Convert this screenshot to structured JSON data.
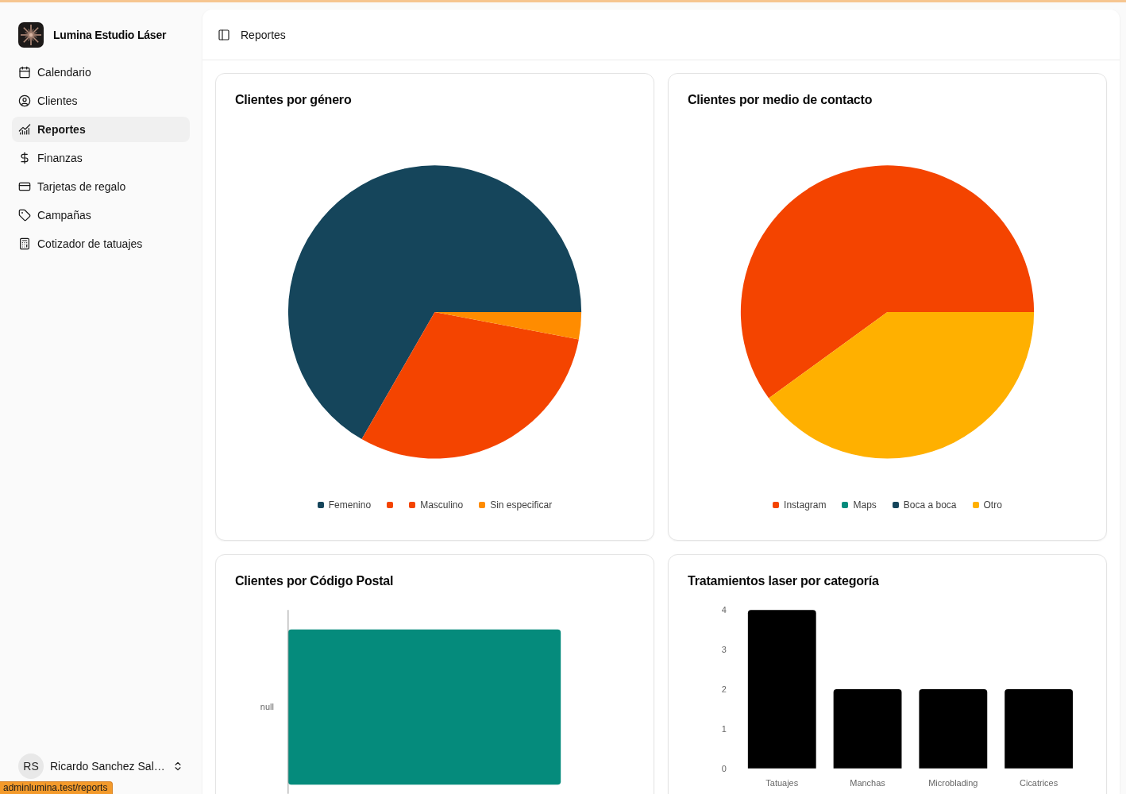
{
  "sidebar": {
    "brand": {
      "name": "Lumina Estudio Láser"
    },
    "items": [
      {
        "label": "Calendario",
        "selected": false
      },
      {
        "label": "Clientes",
        "selected": false
      },
      {
        "label": "Reportes",
        "selected": true
      },
      {
        "label": "Finanzas",
        "selected": false
      },
      {
        "label": "Tarjetas de regalo",
        "selected": false
      },
      {
        "label": "Campañas",
        "selected": false
      },
      {
        "label": "Cotizador de tatuajes",
        "selected": false
      }
    ],
    "user": {
      "initials": "RS",
      "name": "Ricardo Sanchez Sal…"
    }
  },
  "header": {
    "title": "Reportes"
  },
  "cards": [
    {
      "kind": "chart",
      "title": "Clientes por género",
      "chart_data": {
        "type": "pie",
        "categories": [
          "Femenino",
          null,
          "Masculino",
          "Sin especificar"
        ],
        "values": [
          66.7,
          0,
          30.3,
          3.0
        ],
        "colors": [
          "#15455b",
          "#f44400",
          "#f44400",
          "#ff8c00"
        ],
        "legend": "bottom"
      }
    },
    {
      "kind": "chart",
      "title": "Clientes por medio de contacto",
      "chart_data": {
        "type": "pie",
        "categories": [
          "Instagram",
          "Maps",
          "Boca a boca",
          "Otro"
        ],
        "values": [
          60,
          0,
          0,
          40
        ],
        "colors": [
          "#f44400",
          "#058b7c",
          "#15455b",
          "#ffb000"
        ],
        "legend": "bottom"
      }
    },
    {
      "kind": "bar_graphic",
      "title": "Clientes por Código Postal",
      "category": "null"
    },
    {
      "kind": "chart",
      "title": "Tratamientos laser por categoría",
      "chart_data": {
        "type": "bar",
        "orientation": "vertical",
        "categories": [
          "Tatuajes",
          "Manchas",
          "Microblading",
          "Cicatrices"
        ],
        "series": [
          {
            "color": "#000000",
            "values": [
              4,
              2,
              2,
              2
            ]
          }
        ],
        "ylim": [
          0,
          4
        ],
        "yticks": [
          0,
          1,
          2,
          3,
          4
        ]
      }
    }
  ],
  "status_bar": {
    "url": "adminlumina.test/reports"
  }
}
